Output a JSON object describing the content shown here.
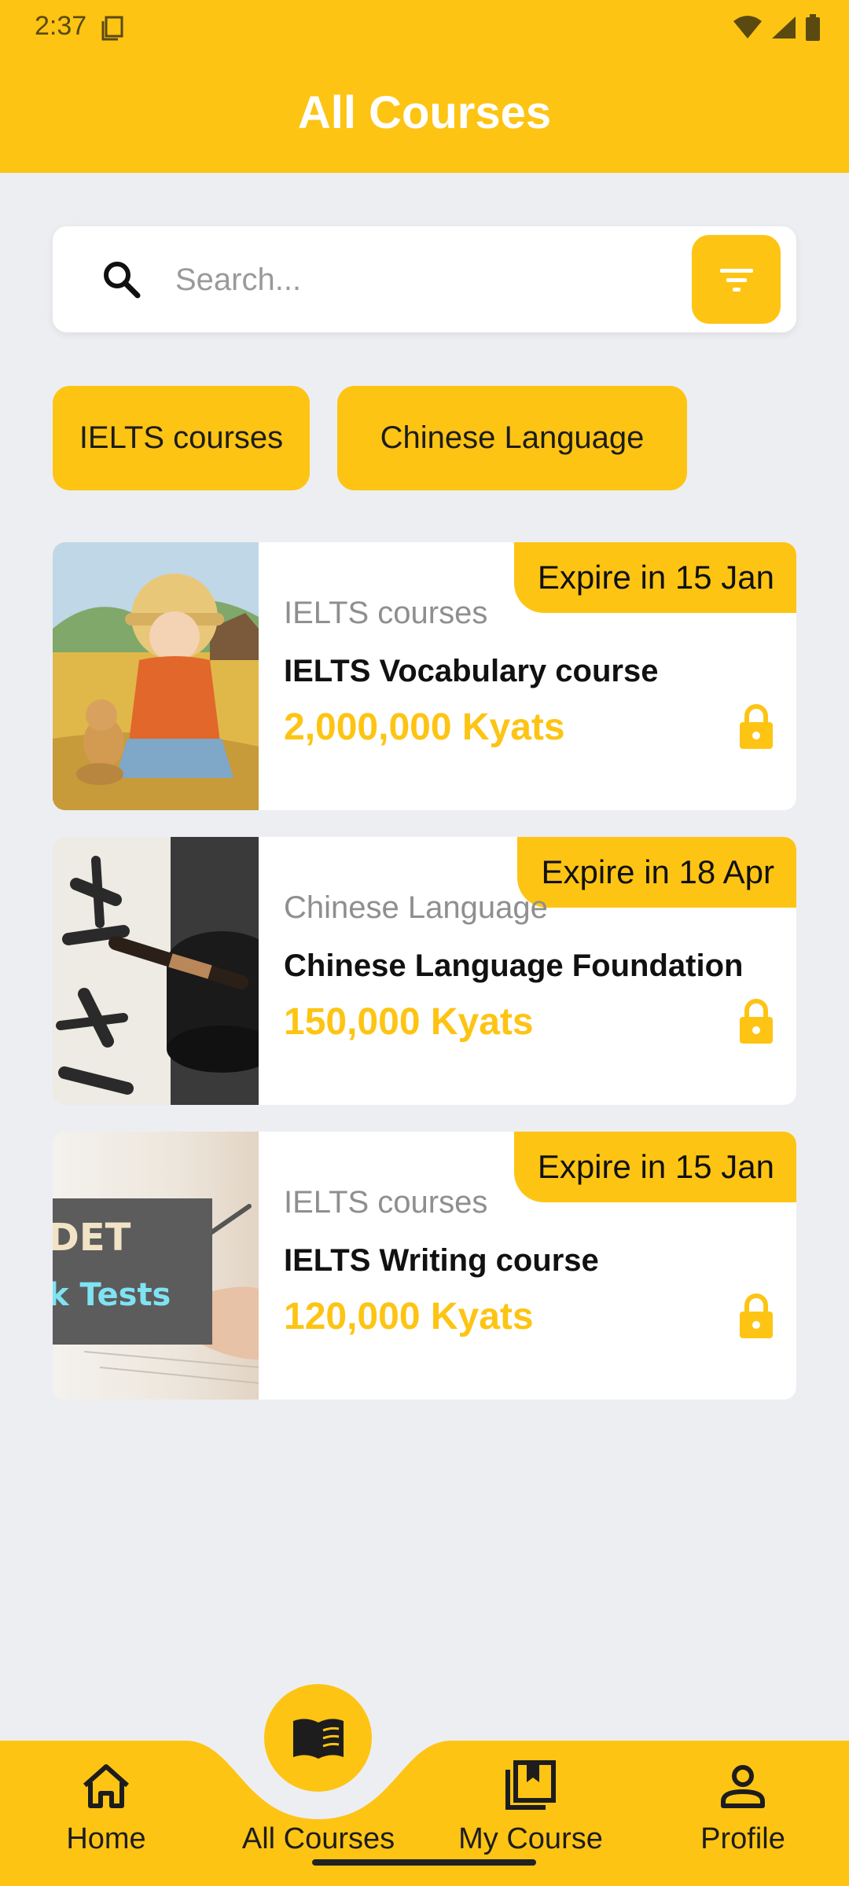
{
  "status_bar": {
    "time": "2:37"
  },
  "header": {
    "title": "All Courses"
  },
  "search": {
    "placeholder": "Search..."
  },
  "categories": [
    {
      "label": "IELTS courses"
    },
    {
      "label": "Chinese Language"
    }
  ],
  "courses": [
    {
      "expire": "Expire in 15 Jan",
      "category": "IELTS courses",
      "title": "IELTS Vocabulary course",
      "price": "2,000,000 Kyats"
    },
    {
      "expire": "Expire in 18 Apr",
      "category": "Chinese Language",
      "title": "Chinese Language Foundation",
      "price": "150,000 Kyats"
    },
    {
      "expire": "Expire in 15 Jan",
      "category": "IELTS courses",
      "title": "IELTS Writing course",
      "price": "120,000 Kyats"
    }
  ],
  "thumbnail_text": {
    "line1": "DET",
    "line2": "k Tests"
  },
  "bottom_nav": [
    {
      "label": "Home"
    },
    {
      "label": "All Courses"
    },
    {
      "label": "My Course"
    },
    {
      "label": "Profile"
    }
  ],
  "colors": {
    "accent": "#FDC414",
    "background": "#EDEEF2",
    "card": "#FFFFFF"
  },
  "icons": [
    "search-icon",
    "filter-icon",
    "lock-icon",
    "home-icon",
    "book-open-icon",
    "bookmark-book-icon",
    "person-icon"
  ]
}
